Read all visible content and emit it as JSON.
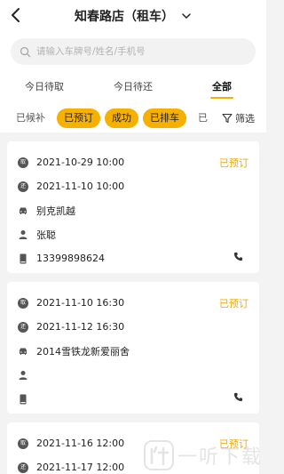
{
  "header": {
    "title": "知春路店（租车）"
  },
  "search": {
    "placeholder": "请输入车牌号/姓名/手机号"
  },
  "tabs": [
    {
      "label": "今日待取"
    },
    {
      "label": "今日待还"
    },
    {
      "label": "全部",
      "active": true
    }
  ],
  "filters": {
    "chips": [
      {
        "label": "已候补",
        "selected": false
      },
      {
        "label": "已预订",
        "selected": true
      },
      {
        "label": "成功",
        "selected": true
      },
      {
        "label": "已排车",
        "selected": true
      },
      {
        "label": "已",
        "selected": false
      }
    ],
    "filter_label": "筛选"
  },
  "orders": [
    {
      "pickup_badge": "取",
      "pickup_time": "2021-10-29 10:00",
      "return_badge": "还",
      "return_time": "2021-11-10 10:00",
      "car": "别克凯越",
      "name": "张聪",
      "phone": "13399898624",
      "status": "已预订"
    },
    {
      "pickup_badge": "取",
      "pickup_time": "2021-11-10 16:30",
      "return_badge": "还",
      "return_time": "2021-11-12 16:30",
      "car": "2014雪铁龙新爱丽舍",
      "name": "",
      "phone": "",
      "status": "已预订"
    },
    {
      "pickup_badge": "取",
      "pickup_time": "2021-11-16 12:00",
      "return_badge": "还",
      "return_time": "2021-11-17 12:00",
      "status": "已预订"
    }
  ],
  "watermark": {
    "text": "一听下载"
  },
  "colors": {
    "accent": "#f6b000",
    "status": "#f2a900",
    "background": "#f3f3f3"
  }
}
